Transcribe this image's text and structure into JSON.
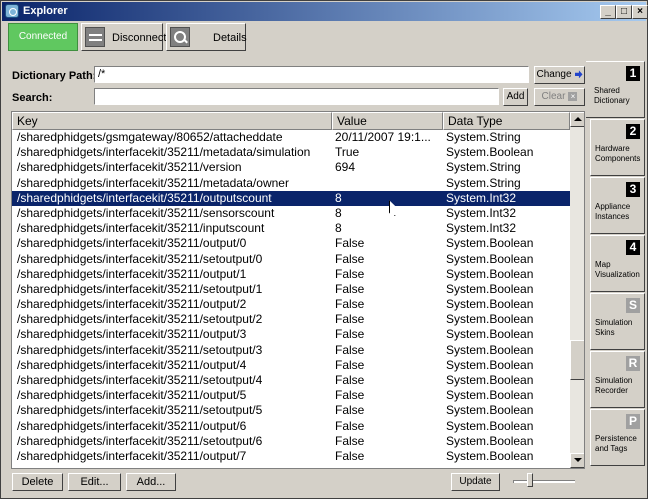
{
  "window": {
    "title": "Explorer",
    "controls": [
      "_",
      "□",
      "×"
    ]
  },
  "toolbar": {
    "connected_label": "Connected",
    "disconnect_label": "Disconnect",
    "details_label": "Details"
  },
  "dictionary": {
    "path_label": "Dictionary Path:",
    "path_value": "/*",
    "change_label": "Change",
    "search_label": "Search:",
    "search_value": "",
    "add_label": "Add",
    "clear_label": "Clear"
  },
  "table": {
    "headers": {
      "key": "Key",
      "value": "Value",
      "datatype": "Data Type"
    },
    "rows": [
      {
        "key": "/sharedphidgets/gsmgateway/80652/attacheddate",
        "value": "20/11/2007 19:1...",
        "type": "System.String"
      },
      {
        "key": "/sharedphidgets/interfacekit/35211/metadata/simulation",
        "value": "True",
        "type": "System.Boolean"
      },
      {
        "key": "/sharedphidgets/interfacekit/35211/version",
        "value": "694",
        "type": "System.String"
      },
      {
        "key": "/sharedphidgets/interfacekit/35211/metadata/owner",
        "value": "",
        "type": "System.String"
      },
      {
        "key": "/sharedphidgets/interfacekit/35211/outputscount",
        "value": "8",
        "type": "System.Int32"
      },
      {
        "key": "/sharedphidgets/interfacekit/35211/sensorscount",
        "value": "8",
        "type": "System.Int32"
      },
      {
        "key": "/sharedphidgets/interfacekit/35211/inputscount",
        "value": "8",
        "type": "System.Int32"
      },
      {
        "key": "/sharedphidgets/interfacekit/35211/output/0",
        "value": "False",
        "type": "System.Boolean"
      },
      {
        "key": "/sharedphidgets/interfacekit/35211/setoutput/0",
        "value": "False",
        "type": "System.Boolean"
      },
      {
        "key": "/sharedphidgets/interfacekit/35211/output/1",
        "value": "False",
        "type": "System.Boolean"
      },
      {
        "key": "/sharedphidgets/interfacekit/35211/setoutput/1",
        "value": "False",
        "type": "System.Boolean"
      },
      {
        "key": "/sharedphidgets/interfacekit/35211/output/2",
        "value": "False",
        "type": "System.Boolean"
      },
      {
        "key": "/sharedphidgets/interfacekit/35211/setoutput/2",
        "value": "False",
        "type": "System.Boolean"
      },
      {
        "key": "/sharedphidgets/interfacekit/35211/output/3",
        "value": "False",
        "type": "System.Boolean"
      },
      {
        "key": "/sharedphidgets/interfacekit/35211/setoutput/3",
        "value": "False",
        "type": "System.Boolean"
      },
      {
        "key": "/sharedphidgets/interfacekit/35211/output/4",
        "value": "False",
        "type": "System.Boolean"
      },
      {
        "key": "/sharedphidgets/interfacekit/35211/setoutput/4",
        "value": "False",
        "type": "System.Boolean"
      },
      {
        "key": "/sharedphidgets/interfacekit/35211/output/5",
        "value": "False",
        "type": "System.Boolean"
      },
      {
        "key": "/sharedphidgets/interfacekit/35211/setoutput/5",
        "value": "False",
        "type": "System.Boolean"
      },
      {
        "key": "/sharedphidgets/interfacekit/35211/output/6",
        "value": "False",
        "type": "System.Boolean"
      },
      {
        "key": "/sharedphidgets/interfacekit/35211/setoutput/6",
        "value": "False",
        "type": "System.Boolean"
      },
      {
        "key": "/sharedphidgets/interfacekit/35211/output/7",
        "value": "False",
        "type": "System.Boolean"
      }
    ],
    "selected_index": 4
  },
  "footer": {
    "delete_label": "Delete",
    "edit_label": "Edit...",
    "add_label": "Add...",
    "update_label": "Update"
  },
  "side_tabs": [
    {
      "num": "1",
      "label": "Shared Dictionary"
    },
    {
      "num": "2",
      "label": "Hardware Components"
    },
    {
      "num": "3",
      "label": "Appliance Instances"
    },
    {
      "num": "4",
      "label": "Map Visualization"
    },
    {
      "num": "S",
      "label": "Simulation Skins"
    },
    {
      "num": "R",
      "label": "Simulation Recorder"
    },
    {
      "num": "P",
      "label": "Persistence and Tags"
    }
  ],
  "colors": {
    "connected": "#60c860",
    "selection": "#0a246a",
    "titlebar": "#0a246a"
  }
}
